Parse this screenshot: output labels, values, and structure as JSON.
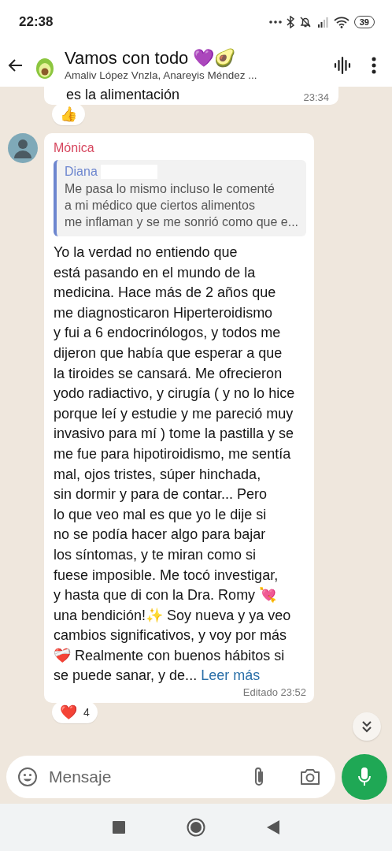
{
  "status_bar": {
    "time": "22:38",
    "battery": "39"
  },
  "header": {
    "title": "Vamos con todo 💜🥑",
    "subtitle": "Amaliv López Vnzla, Anareyis Méndez ..."
  },
  "messages": [
    {
      "kind": "tail",
      "text": "es la alimentación",
      "time": "23:34",
      "reaction": {
        "emoji": "👍"
      }
    },
    {
      "kind": "incoming",
      "sender": "Mónica",
      "color": "#d6455d",
      "quote": {
        "sender": "Diana",
        "color": "#6d86cf",
        "text": "Me pasa lo mismo incluso le comenté\na mi médico que ciertos alimentos\nme inflaman y se me sonrió como que e..."
      },
      "text": "Yo la verdad no entiendo que\nestá pasando en el mundo de la\nmedicina. Hace más de 2 años que\nme diagnosticaron Hiperteroidismo\ny fui a 6 endocrinólogos, y todos me\ndijeron que había que esperar a que\nla tiroides se cansará. Me ofrecieron\nyodo radiactivo, y cirugía ( y no lo hice\nporque leí y estudie y me pareció muy\ninvasivo para mí ) tome la pastilla y se\nme fue para hipotiroidismo, me sentía\nmal, ojos tristes, súper hinchada,\nsin dormir y para de contar... Pero\nlo que veo mal es que yo le dije si\nno se podía hacer algo para bajar\nlos síntomas, y te miran como si\nfuese imposible. Me tocó investigar,\ny hasta que di con la Dra. Romy 💘\nuna bendición!✨ Soy nueva y ya veo\ncambios significativos, y voy por más\n❤️‍🩹 Realmente con buenos hábitos si\nse puede sanar, y de... ",
      "link": "Leer más",
      "time": "Editado 23:52",
      "reaction": {
        "emoji": "❤️",
        "count": "4"
      }
    }
  ],
  "composer": {
    "placeholder": "Mensaje"
  }
}
